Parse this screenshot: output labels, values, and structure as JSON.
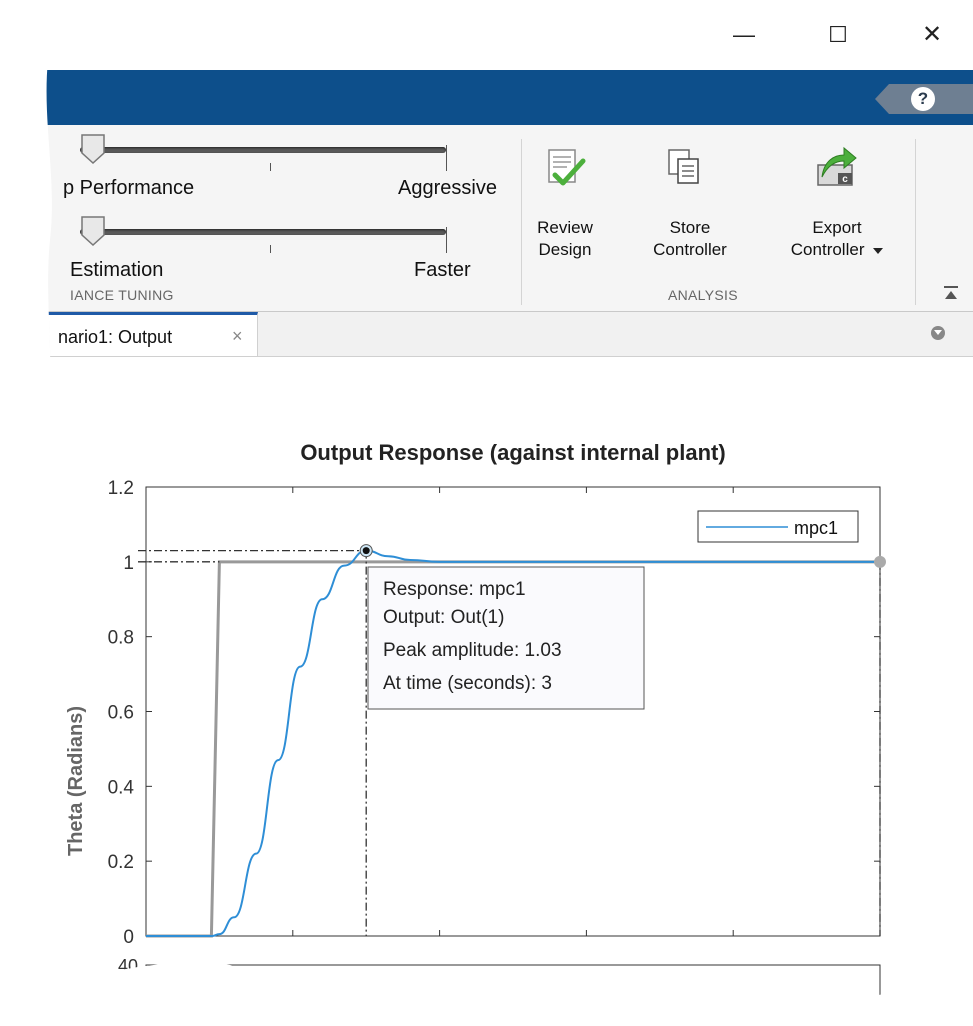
{
  "window": {
    "controls": {
      "minimize": "—",
      "maximize": "☐",
      "close": "✕"
    }
  },
  "header": {
    "help_label": "?"
  },
  "ribbon": {
    "tuning": {
      "slider1_left_label": "p Performance",
      "slider1_right_label": "Aggressive",
      "slider1_value": 0.0,
      "slider2_left_label": "Estimation",
      "slider2_right_label": "Faster",
      "slider2_value": 0.0,
      "section_label": "IANCE TUNING"
    },
    "analysis": {
      "section_label": "ANALYSIS",
      "review": {
        "line1": "Review",
        "line2": "Design",
        "icon": "review-design-icon"
      },
      "store": {
        "line1": "Store",
        "line2": "Controller",
        "icon": "store-controller-icon"
      },
      "export": {
        "line1": "Export",
        "line2": "Controller",
        "icon": "export-controller-icon"
      }
    }
  },
  "tabs": [
    {
      "label": "nario1: Output",
      "close": "×"
    }
  ],
  "colors": {
    "accent": "#0d4f8b",
    "series": "#2e8ed6",
    "reference": "#999999"
  },
  "chart_data": {
    "type": "line",
    "title": "Output Response (against internal plant)",
    "ylabel": "Theta (Radians)",
    "ylim": [
      0,
      1.2
    ],
    "yticks": [
      "0",
      "0.2",
      "0.4",
      "0.6",
      "0.8",
      "1",
      "1.2"
    ],
    "x": [
      0,
      0.5,
      0.9,
      1.0,
      1.2,
      1.5,
      1.8,
      2.1,
      2.4,
      2.7,
      3.0,
      3.3,
      3.6,
      4.0,
      5.0,
      6.0,
      7.0,
      8.0,
      10.0
    ],
    "series": [
      {
        "name": "mpc1",
        "values": [
          0,
          0,
          0,
          0.005,
          0.05,
          0.22,
          0.47,
          0.72,
          0.9,
          0.99,
          1.03,
          1.015,
          1.005,
          1.0,
          1.0,
          1.0,
          1.0,
          1.0,
          1.0
        ]
      }
    ],
    "reference": {
      "step_time": 1.0,
      "value": 1.0
    },
    "legend_position": "top-right",
    "next_axis_partial_label": "40",
    "datatip": {
      "line1": "Response: mpc1",
      "line2": "Output: Out(1)",
      "line3": "Peak amplitude: 1.03",
      "line4": "At time (seconds): 3",
      "peak_time": 3,
      "peak_value": 1.03
    }
  }
}
